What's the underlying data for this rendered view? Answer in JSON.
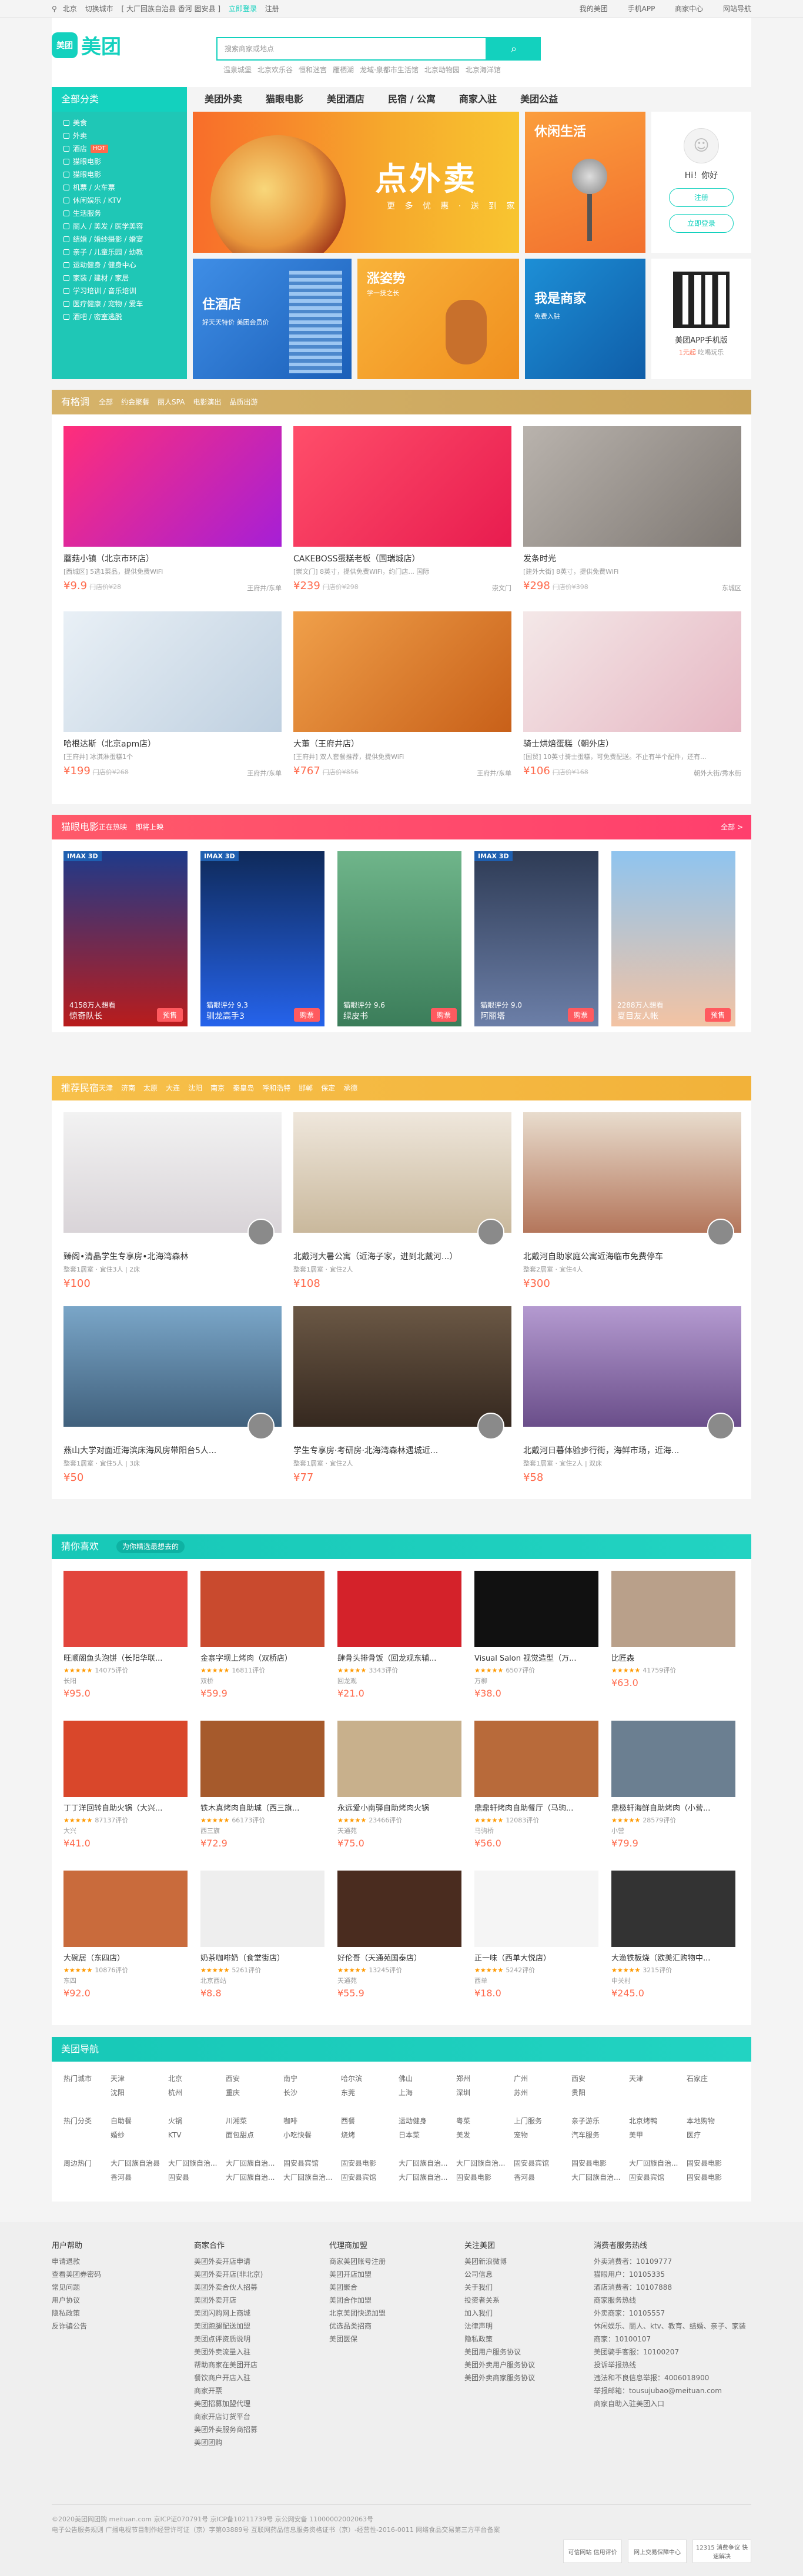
{
  "topbar": {
    "city": "北京",
    "switch_city": "切换城市",
    "nearby": "[ 大厂回族自治县 香河 固安县 ]",
    "login": "立即登录",
    "register": "注册",
    "my_meituan": "我的美团",
    "app": "手机APP",
    "merchant": "商家中心",
    "nav_more": "网站导航"
  },
  "header": {
    "logo_mark": "美团",
    "logo_word": "美团",
    "search_placeholder": "搜索商家或地点",
    "search_icon": "search-icon",
    "hotwords": [
      "温泉城堡",
      "北京欢乐谷",
      "恒和迷宫",
      "雁栖湖",
      "龙域·泉都市生活馆",
      "北京动物园",
      "北京海洋馆"
    ]
  },
  "nav": {
    "all": "全部分类",
    "links": [
      "美团外卖",
      "猫眼电影",
      "美团酒店",
      "民宿 / 公寓",
      "商家入驻",
      "美团公益"
    ]
  },
  "categories": [
    {
      "label": "美食",
      "badge": ""
    },
    {
      "label": "外卖",
      "badge": ""
    },
    {
      "label": "酒店",
      "badge": "HOT"
    },
    {
      "label": "猫眼电影",
      "badge": ""
    },
    {
      "label": "猫眼电影",
      "badge": ""
    },
    {
      "label": "机票 / 火车票",
      "badge": ""
    },
    {
      "label": "休闲娱乐 / KTV",
      "badge": ""
    },
    {
      "label": "生活服务",
      "badge": ""
    },
    {
      "label": "丽人 / 美发 / 医学美容",
      "badge": ""
    },
    {
      "label": "结婚 / 婚纱摄影 / 婚宴",
      "badge": ""
    },
    {
      "label": "亲子 / 儿童乐园 / 幼教",
      "badge": ""
    },
    {
      "label": "运动健身 / 健身中心",
      "badge": ""
    },
    {
      "label": "家装 / 建材 / 家居",
      "badge": ""
    },
    {
      "label": "学习培训 / 音乐培训",
      "badge": ""
    },
    {
      "label": "医疗健康 / 宠物 / 爱车",
      "badge": ""
    },
    {
      "label": "酒吧 / 密室逃脱",
      "badge": ""
    }
  ],
  "hero": {
    "banner_title": "点外卖",
    "banner_sub": "更 多 优 惠 · 送 到 家",
    "tiles": [
      {
        "title": "休闲生活",
        "sub": ""
      },
      {
        "title": "住酒店",
        "sub": "好天天特价 美团会员价"
      },
      {
        "title": "涨姿势",
        "sub": "学一技之长"
      },
      {
        "title": "我是商家",
        "sub": "免费入驻"
      }
    ],
    "user": {
      "greeting": "Hi！你好",
      "register": "注册",
      "login": "立即登录"
    },
    "app": {
      "title": "美团APP手机版",
      "sub_pre": "1元起",
      "sub_post": "吃喝玩乐"
    }
  },
  "deals": {
    "title": "有格调",
    "tabs": [
      "全部",
      "约会聚餐",
      "丽人SPA",
      "电影演出",
      "品质出游"
    ],
    "items": [
      {
        "name": "蘑菇小镇（北京市环店）",
        "sub": "[西城区] 5选1菜品，提供免费WiFi",
        "price": "¥9.9",
        "old": "门店价¥28",
        "loc": "王府井/东单"
      },
      {
        "name": "CAKEBOSS蛋糕老板（国瑞城店）",
        "sub": "[崇文门] 8英寸，提供免费WiFi，约门店... 国际",
        "price": "¥239",
        "old": "门店价¥298",
        "loc": "崇文门"
      },
      {
        "name": "发条时光",
        "sub": "[建外大街] 8英寸，提供免费WiFi",
        "price": "¥298",
        "old": "门店价¥398",
        "loc": "东城区"
      },
      {
        "name": "哈根达斯（北京apm店）",
        "sub": "[王府井] 冰淇淋蛋糕1个",
        "price": "¥199",
        "old": "门店价¥268",
        "loc": "王府井/东单"
      },
      {
        "name": "大董（王府井店）",
        "sub": "[王府井] 双人套餐推荐，提供免费WiFi",
        "price": "¥767",
        "old": "门店价¥856",
        "loc": "王府井/东单"
      },
      {
        "name": "骑士烘焙蛋糕（朝外店）",
        "sub": "[国贸] 10英寸骑士蛋糕，可免费配送。不止有半个配件，还有...",
        "price": "¥106",
        "old": "门店价¥168",
        "loc": "朝外大街/秀水街"
      }
    ]
  },
  "movies": {
    "title": "猫眼电影",
    "tabs": [
      "正在热映",
      "即将上映"
    ],
    "more": "全部 >",
    "items": [
      {
        "name": "惊奇队长",
        "score": "4158万人想看",
        "buy": "预售",
        "imax": "IMAX 3D"
      },
      {
        "name": "驯龙高手3",
        "score": "猫眼评分 9.3",
        "buy": "购票",
        "imax": "IMAX 3D"
      },
      {
        "name": "绿皮书",
        "score": "猫眼评分 9.6",
        "buy": "购票",
        "imax": ""
      },
      {
        "name": "阿丽塔",
        "score": "猫眼评分 9.0",
        "buy": "购票",
        "imax": "IMAX 3D"
      },
      {
        "name": "夏目友人帐",
        "score": "2288万人想看",
        "buy": "预售",
        "imax": ""
      }
    ]
  },
  "stays": {
    "title": "推荐民宿",
    "tabs": [
      "天津",
      "济南",
      "太原",
      "大连",
      "沈阳",
      "南京",
      "秦皇岛",
      "呼和浩特",
      "邯郸",
      "保定",
      "承德"
    ],
    "items": [
      {
        "name": "臻阁•清晶学生专享房•北海湾森林",
        "sub": "整套1居室 · 宜住3人 | 2床",
        "price": "¥100"
      },
      {
        "name": "北戴河大暑公寓（近海子家，进到北戴河...）",
        "sub": "整套1居室 · 宜住2人",
        "price": "¥108"
      },
      {
        "name": "北戴河自助家庭公寓近海临市免费停车",
        "sub": "整套2居室 · 宜住4人",
        "price": "¥300"
      },
      {
        "name": "燕山大学对面近海滨床海风房带阳台5人...",
        "sub": "整套1居室 · 宜住5人 | 3床",
        "price": "¥50"
      },
      {
        "name": "学生专享房·考研房·北海湾森林遇城近...",
        "sub": "整套1居室 · 宜住2人",
        "price": "¥77"
      },
      {
        "name": "北戴河日暮体验步行街，海鲜市场，近海...",
        "sub": "整套1居室 · 宜住2人 | 双床",
        "price": "¥58"
      }
    ]
  },
  "guess": {
    "title": "猜你喜欢",
    "sub": "为你精选最想去的",
    "items": [
      {
        "name": "旺顺阁鱼头泡饼（长阳华联...",
        "reviews": "14075评价",
        "area": "长阳",
        "price": "¥95.0"
      },
      {
        "name": "金寨字坝上烤肉（双桥店）",
        "reviews": "16811评价",
        "area": "双桥",
        "price": "¥59.9"
      },
      {
        "name": "肆骨头排骨饭（回龙观东辅...",
        "reviews": "3343评价",
        "area": "回龙观",
        "price": "¥21.0"
      },
      {
        "name": "Visual Salon 视觉造型（万...",
        "reviews": "6507评价",
        "area": "万柳",
        "price": "¥38.0"
      },
      {
        "name": "比匠森",
        "reviews": "41759评价",
        "area": "",
        "price": "¥63.0"
      },
      {
        "name": "丁丁洋回转自助火锅（大兴...",
        "reviews": "87137评价",
        "area": "大兴",
        "price": "¥41.0"
      },
      {
        "name": "铁木真烤肉自助城（西三旗...",
        "reviews": "66173评价",
        "area": "西三旗",
        "price": "¥72.9"
      },
      {
        "name": "永远爱小南驿自助烤肉火锅",
        "reviews": "23466评价",
        "area": "天通苑",
        "price": "¥75.0"
      },
      {
        "name": "鼎鼎轩烤肉自助餐厅（马驹...",
        "reviews": "12083评价",
        "area": "马驹桥",
        "price": "¥56.0"
      },
      {
        "name": "鼎极轩海鲜自助烤肉（小营...",
        "reviews": "28579评价",
        "area": "小营",
        "price": "¥79.9"
      },
      {
        "name": "大碗居（东四店）",
        "reviews": "10876评价",
        "area": "东四",
        "price": "¥92.0"
      },
      {
        "name": "奶茶咖啡奶（食堂街店）",
        "reviews": "5261评价",
        "area": "北京西站",
        "price": "¥8.8"
      },
      {
        "name": "好伦哥（天通苑国泰店）",
        "reviews": "13245评价",
        "area": "天通苑",
        "price": "¥55.9"
      },
      {
        "name": "正一味（西单大悦店）",
        "reviews": "5242评价",
        "area": "西单",
        "price": "¥18.0"
      },
      {
        "name": "大渔铁板烧（欧美汇购物中...",
        "reviews": "3215评价",
        "area": "中关村",
        "price": "¥245.0"
      }
    ]
  },
  "guide": {
    "title": "美团导航",
    "rows": [
      {
        "label": "热门城市",
        "items": [
          "天津",
          "北京",
          "西安",
          "南宁",
          "哈尔滨",
          "佛山",
          "郑州",
          "广州",
          "西安",
          "天津",
          "石家庄",
          "沈阳",
          "杭州",
          "重庆",
          "长沙",
          "东莞",
          "上海",
          "深圳",
          "苏州",
          "贵阳"
        ]
      },
      {
        "label": "热门分类",
        "items": [
          "自助餐",
          "火锅",
          "川湘菜",
          "咖啡",
          "西餐",
          "运动健身",
          "粤菜",
          "上门服务",
          "亲子游乐",
          "北京烤鸭",
          "本地购物",
          "婚纱",
          "KTV",
          "面包甜点",
          "小吃快餐",
          "烧烤",
          "日本菜",
          "美发",
          "宠物",
          "汽车服务",
          "美甲",
          "医疗"
        ]
      },
      {
        "label": "周边热门",
        "items": [
          "大厂回族自治县",
          "大厂回族自治...",
          "大厂回族自治...",
          "固安县宾馆",
          "固安县电影",
          "大厂回族自治...",
          "大厂回族自治...",
          "固安县宾馆",
          "固安县电影",
          "大厂回族自治...",
          "固安县电影",
          "香河县",
          "固安县",
          "大厂回族自治...",
          "大厂回族自治...",
          "固安县宾馆",
          "大厂回族自治...",
          "固安县电影",
          "香河县",
          "大厂回族自治...",
          "固安县宾馆",
          "固安县电影"
        ]
      }
    ]
  },
  "footer": {
    "cols": [
      {
        "title": "用户帮助",
        "items": [
          "申请退款",
          "查看美团券密码",
          "常见问题",
          "用户协议",
          "隐私政策",
          "反诈骗公告"
        ]
      },
      {
        "title": "商家合作",
        "items": [
          "美团外卖开店申请",
          "美团外卖开店(非北京)",
          "美团外卖合伙人招募",
          "美团外卖开店",
          "美团闪购网上商城",
          "美团跑腿配送加盟",
          "美团点评资质说明",
          "美团外卖流量入驻",
          "帮助商家在美团开店",
          "餐饮商户开店入驻",
          "商家开票",
          "美团招募加盟代理",
          "商家开店订货平台",
          "美团外卖服务商招募",
          "美团团购"
        ]
      },
      {
        "title": "代理商加盟",
        "items": [
          "商家美团账号注册",
          "美团开店加盟",
          "美团聚合",
          "美团合作加盟",
          "北京美团快递加盟",
          "优选品类招商",
          "美团医保"
        ]
      },
      {
        "title": "关注美团",
        "items": [
          "美团新浪微博",
          "公司信息",
          "关于我们",
          "投资者关系",
          "加入我们",
          "法律声明",
          "隐私政策",
          "美团用户服务协议",
          "美团外卖用户服务协议",
          "美团外卖商家服务协议"
        ]
      },
      {
        "title": "消费者服务热线",
        "items": [
          "外卖消费者：10109777",
          "猫眼用户：10105335",
          "酒店消费者：10107888",
          "商家服务热线",
          "外卖商家：10105557",
          "休闲娱乐、丽人、ktv、教育、结婚、亲子、家装商家：10100107",
          "美团骑手客服：10100207",
          "投诉举报热线",
          "违法和不良信息举报：4006018900",
          "举报邮箱：tousujubao@meituan.com",
          "商家自助入驻美团入口"
        ]
      }
    ],
    "copyright": "©2020美团网团购 meituan.com  京ICP证070791号  京ICP备10211739号  京公网安备 11000002002063号",
    "license": "电子公告服务规则  广播电视节目制作经营许可证（京）字第03889号  互联网药品信息服务资格证书（京）-经营性-2016-0011  网络食品交易第三方平台备案",
    "badges": [
      "可信网站 信用评价",
      "网上交易保障中心",
      "12315 消费争议 快速解决"
    ]
  }
}
